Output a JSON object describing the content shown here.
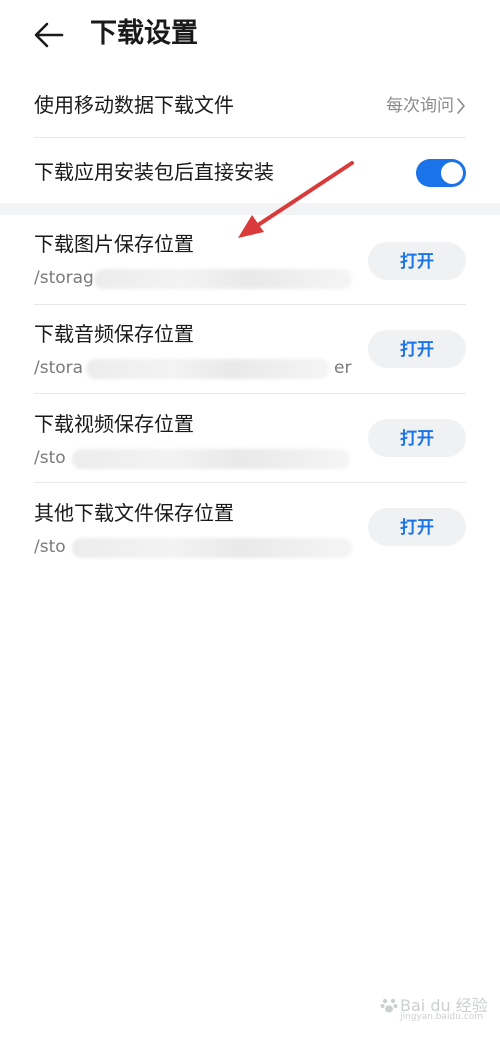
{
  "header": {
    "title": "下载设置"
  },
  "settings": {
    "mobile_data": {
      "label": "使用移动数据下载文件",
      "value": "每次询问"
    },
    "auto_install": {
      "label": "下载应用安装包后直接安装",
      "enabled": true
    }
  },
  "locations": [
    {
      "label": "下载图片保存位置",
      "path": "/storag",
      "button": "打开"
    },
    {
      "label": "下载音频保存位置",
      "path": "/stora",
      "path_tail": "er",
      "button": "打开"
    },
    {
      "label": "下载视频保存位置",
      "path": "/sto",
      "button": "打开"
    },
    {
      "label": "其他下载文件保存位置",
      "path": "/sto",
      "button": "打开"
    }
  ],
  "colors": {
    "accent": "#1a73e8",
    "annotation_arrow": "#d93a3a"
  },
  "watermark": {
    "text": "Bai du 经验",
    "sub": "jingyan.baidu.com"
  }
}
